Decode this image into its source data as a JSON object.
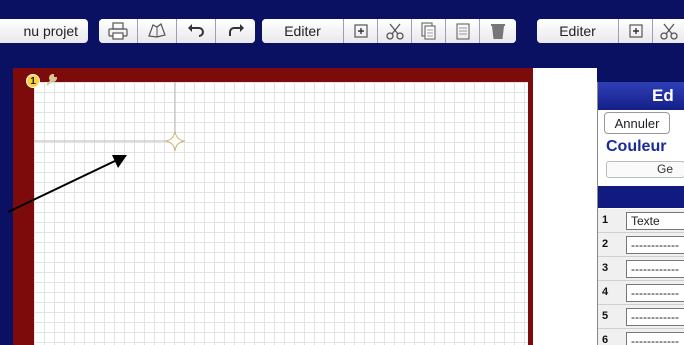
{
  "toolbar": {
    "menu_label": "nu projet",
    "edit_label_1": "Editer",
    "edit_label_2": "Editer"
  },
  "canvas": {
    "layer_badge": "1"
  },
  "panel": {
    "title": "Ed",
    "cancel_label": "Annuler",
    "color_label": "Couleur",
    "ge_label": "Ge",
    "rows": [
      {
        "num": "1",
        "value": "Texte"
      },
      {
        "num": "2",
        "value": "------------"
      },
      {
        "num": "3",
        "value": "------------"
      },
      {
        "num": "4",
        "value": "------------"
      },
      {
        "num": "5",
        "value": "------------"
      },
      {
        "num": "6",
        "value": "------------"
      }
    ]
  },
  "colors": {
    "toolbar_bg": "#0a1163",
    "frame": "#7d0b0b",
    "panel_title": "#1a2c9a"
  },
  "icons": [
    "printer-icon",
    "open-book-icon",
    "undo-icon",
    "redo-icon",
    "add-icon",
    "scissors-icon",
    "copy-icon",
    "paste-icon",
    "trash-icon",
    "wrench-icon",
    "sparkle-marker-icon",
    "arrow-pointer-icon"
  ]
}
